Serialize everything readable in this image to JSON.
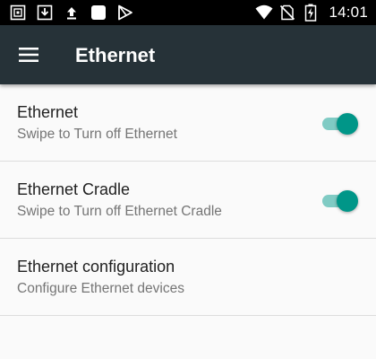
{
  "status_bar": {
    "left_icons": [
      "screenshot-icon",
      "download-icon",
      "upload-icon",
      "app-square-icon",
      "play-store-icon"
    ],
    "right_icons": [
      "wifi-icon",
      "no-sim-icon",
      "battery-charging-icon"
    ],
    "time": "14:01"
  },
  "app_bar": {
    "title": "Ethernet",
    "menu_icon": "menu-icon"
  },
  "settings": [
    {
      "title": "Ethernet",
      "summary": "Swipe to Turn off Ethernet",
      "switch_on": true
    },
    {
      "title": "Ethernet Cradle",
      "summary": "Swipe to Turn off Ethernet Cradle",
      "switch_on": true
    },
    {
      "title": "Ethernet configuration",
      "summary": "Configure Ethernet devices"
    }
  ],
  "colors": {
    "status_bar": "#000000",
    "app_bar": "#263238",
    "accent": "#009688",
    "accent_track": "#80cbc4",
    "background": "#fafafa"
  }
}
